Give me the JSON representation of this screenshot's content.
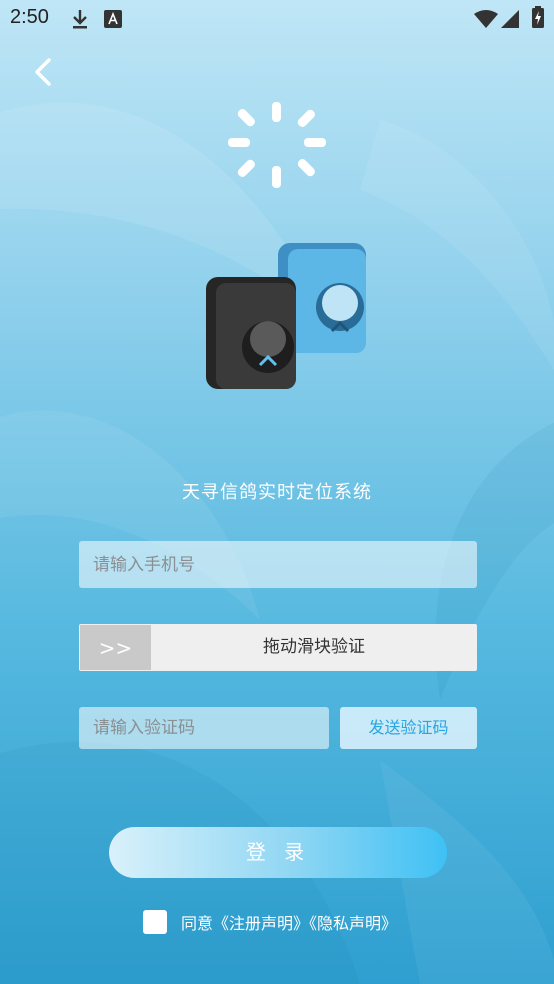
{
  "status_bar": {
    "time": "2:50"
  },
  "app": {
    "title": "天寻信鸽实时定位系统"
  },
  "form": {
    "phone_placeholder": "请输入手机号",
    "slider_text": "拖动滑块验证",
    "slider_arrows": ">>",
    "code_placeholder": "请输入验证码",
    "send_code_label": "发送验证码",
    "login_label": "登 录",
    "agree_text": "同意《注册声明》《隐私声明》"
  },
  "colors": {
    "accent": "#2aa5df",
    "login_start": "#d9f1fb",
    "login_end": "#3ec1f4"
  }
}
